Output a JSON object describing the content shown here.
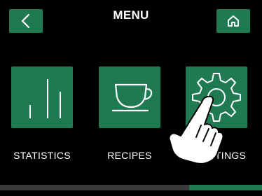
{
  "header": {
    "title": "MENU",
    "back_icon": "chevron-left-icon",
    "home_icon": "home-icon"
  },
  "menu": {
    "items": [
      {
        "label": "STATISTICS",
        "icon": "bar-chart-icon"
      },
      {
        "label": "RECIPES",
        "icon": "coffee-cup-icon"
      },
      {
        "label": "SETTINGS",
        "icon": "gear-icon"
      }
    ]
  },
  "colors": {
    "accent": "#1f7a52",
    "background": "#000000",
    "scroll_track": "#3a3a3a"
  }
}
